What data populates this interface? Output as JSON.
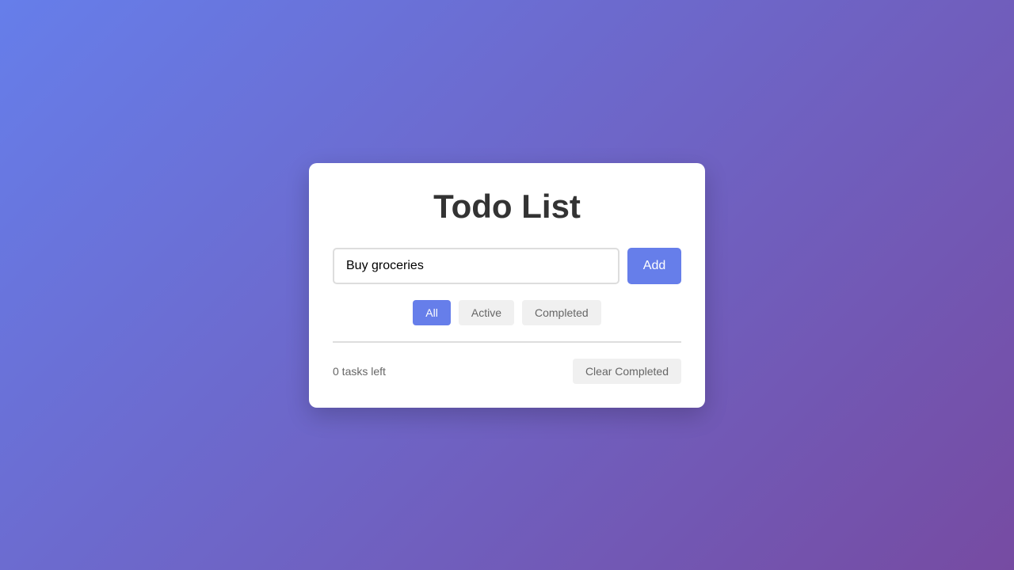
{
  "app": {
    "title": "Todo List"
  },
  "input": {
    "value": "Buy groceries",
    "add_label": "Add"
  },
  "filters": [
    {
      "label": "All",
      "active": true
    },
    {
      "label": "Active",
      "active": false
    },
    {
      "label": "Completed",
      "active": false
    }
  ],
  "todos": [],
  "footer": {
    "tasks_left": "0 tasks left",
    "clear_label": "Clear Completed"
  },
  "colors": {
    "accent": "#667eea",
    "background_start": "#667eea",
    "background_end": "#764ba2",
    "title_text": "#333333",
    "muted_text": "#666666"
  }
}
